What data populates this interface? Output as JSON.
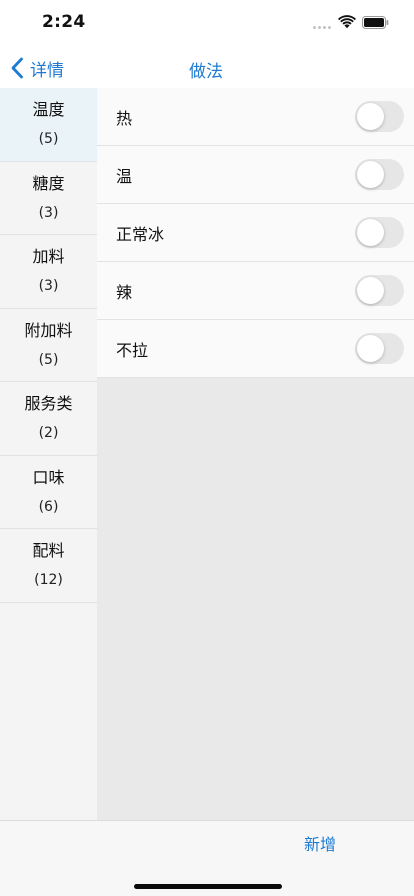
{
  "status_bar": {
    "time": "2:24"
  },
  "nav": {
    "back_label": "详情",
    "title": "做法"
  },
  "categories": [
    {
      "name": "温度",
      "count": "(5)",
      "selected": true
    },
    {
      "name": "糖度",
      "count": "(3)"
    },
    {
      "name": "加料",
      "count": "(3)"
    },
    {
      "name": "附加料",
      "count": "(5)"
    },
    {
      "name": "服务类",
      "count": "(2)"
    },
    {
      "name": "口味",
      "count": "(6)"
    },
    {
      "name": "配料",
      "count": "(12)"
    }
  ],
  "options": [
    {
      "label": "热",
      "on": false
    },
    {
      "label": "温",
      "on": false
    },
    {
      "label": "正常冰",
      "on": false
    },
    {
      "label": "辣",
      "on": false
    },
    {
      "label": "不拉",
      "on": false
    }
  ],
  "toolbar": {
    "add_label": "新增"
  },
  "colors": {
    "accent": "#1f7ad1",
    "selected_bg": "#eaf4f8",
    "toggle_off": "#e6e6e6"
  }
}
